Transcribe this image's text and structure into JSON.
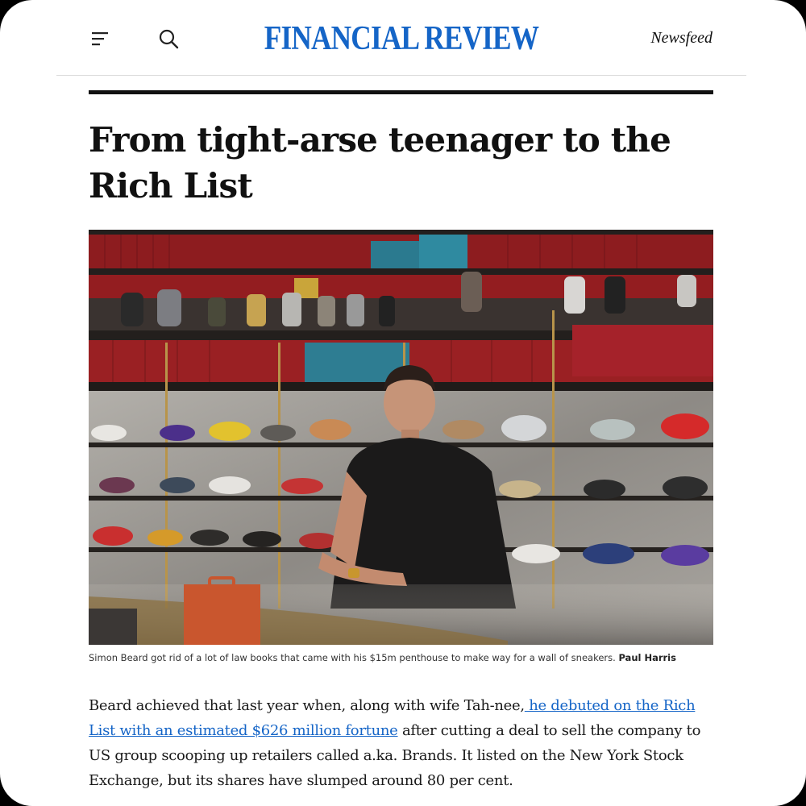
{
  "header": {
    "menu_icon": "hamburger-menu-icon",
    "search_icon": "search-icon",
    "masthead": "FINANCIAL REVIEW",
    "newsfeed_label": "Newsfeed"
  },
  "article": {
    "headline": "From tight-arse teenager to the Rich List",
    "photo": {
      "caption": "Simon Beard got rid of a lot of law books that came with his $15m penthouse to make way for a wall of sneakers.",
      "credit": "Paul Harris"
    },
    "body": {
      "lead": "Beard achieved that last year when, along with wife Tah-nee,",
      "link_text": " he debuted on the Rich List with an estimated $626 million fortune",
      "rest": " after cutting a deal to sell the company to US group scooping up retailers called a.ka. Brands. It listed on the New York Stock Exchange, but its shares have slumped around 80 per cent."
    }
  },
  "colors": {
    "brand": "#1565c7",
    "text": "#111111",
    "link": "#1565c7"
  }
}
